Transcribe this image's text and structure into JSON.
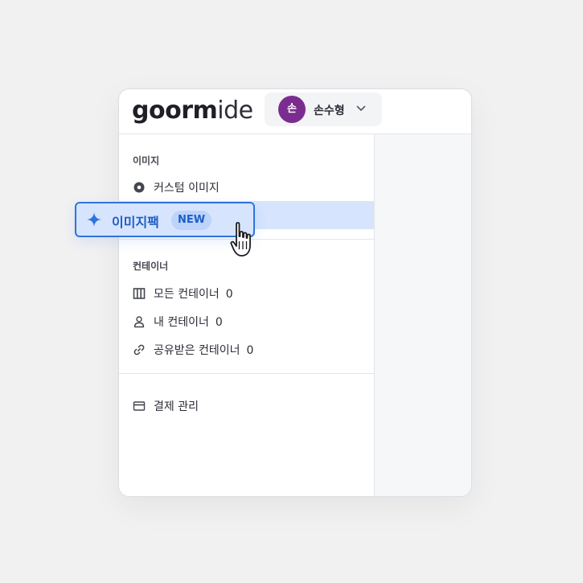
{
  "header": {
    "logo_bold": "goorm",
    "logo_light": "ide",
    "user": {
      "avatar_initial": "손",
      "name": "손수형",
      "avatar_color": "#7b2d8f"
    }
  },
  "sidebar": {
    "images_section": {
      "title": "이미지",
      "items": [
        {
          "label": "커스텀 이미지",
          "icon": "disc-icon"
        },
        {
          "label": "이미지팩",
          "icon": "sparkle-icon",
          "badge": "NEW"
        }
      ]
    },
    "containers_section": {
      "title": "컨테이너",
      "items": [
        {
          "label": "모든 컨테이너",
          "count": "0",
          "icon": "columns-icon"
        },
        {
          "label": "내 컨테이너",
          "count": "0",
          "icon": "user-icon"
        },
        {
          "label": "공유받은 컨테이너",
          "count": "0",
          "icon": "link-icon"
        }
      ]
    },
    "billing": {
      "label": "결제 관리",
      "icon": "card-icon"
    }
  },
  "colors": {
    "accent": "#2f73dd",
    "active_bg": "#d6e4fd"
  }
}
